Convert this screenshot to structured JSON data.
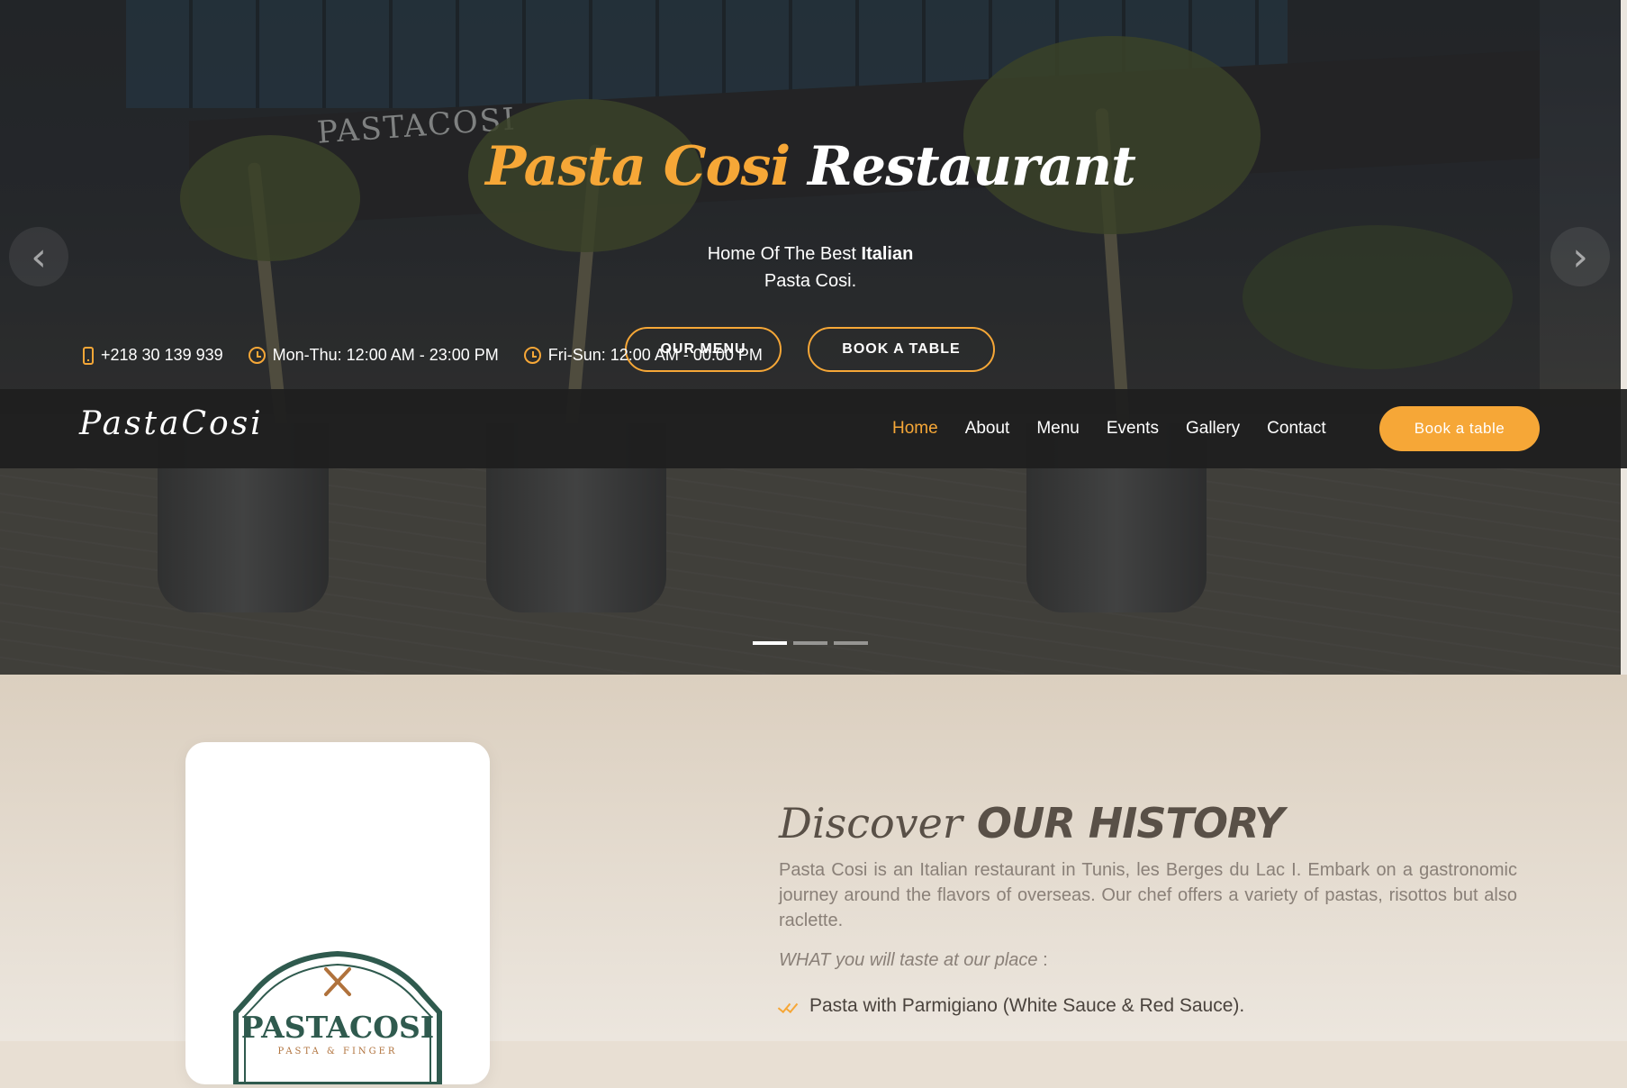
{
  "hero": {
    "storefront_sign": "PASTACOSI",
    "title_accent": "Pasta Cosi",
    "title_rest": "Restaurant",
    "subtitle_line1_prefix": "Home Of The Best",
    "subtitle_line1_bold": "Italian",
    "subtitle_line2": "Pasta Cosi.",
    "btn_menu": "OUR MENU",
    "btn_book": "BOOK A TABLE",
    "prev_icon": "chevron-left-icon",
    "next_icon": "chevron-right-icon",
    "slides": 3,
    "active_slide": 1
  },
  "topbar": {
    "phone": "+218 30 139 939",
    "hours_weekday": "Mon-Thu: 12:00 AM - 23:00 PM",
    "hours_weekend": "Fri-Sun: 12:00 AM - 00:00 PM"
  },
  "navbar": {
    "logo": "PastaCosi",
    "items": [
      {
        "label": "Home",
        "active": true
      },
      {
        "label": "About",
        "active": false
      },
      {
        "label": "Menu",
        "active": false
      },
      {
        "label": "Events",
        "active": false
      },
      {
        "label": "Gallery",
        "active": false
      },
      {
        "label": "Contact",
        "active": false
      }
    ],
    "cta": "Book a table"
  },
  "about": {
    "title_light": "Discover",
    "title_bold": "OUR HISTORY",
    "paragraph": "Pasta Cosi is an Italian restaurant in Tunis, les Berges du Lac I. Embark on a gastronomic journey around the flavors of overseas. Our chef offers a variety of pastas, risottos but also raclette.",
    "taste_label": "WHAT you will taste at our place",
    "taste_colon": " :",
    "items": [
      "Pasta with Parmigiano (White Sauce & Red Sauce)."
    ],
    "emblem_text": "PASTACOSI",
    "emblem_subtext": "PASTA & FINGER"
  },
  "colors": {
    "accent": "#f6a737",
    "navbar_bg": "#1e1e1e",
    "about_bg": "#e4dbcf",
    "emblem_green": "#2f5a4e"
  }
}
